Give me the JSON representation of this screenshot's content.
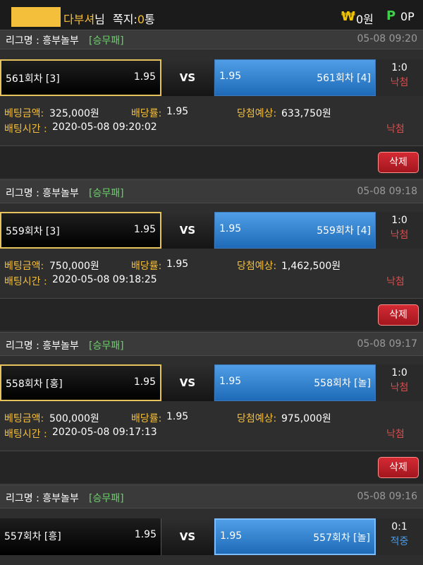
{
  "header": {
    "nickname_suffix": "다부셔",
    "honorific": "님",
    "message_label": "쪽지:",
    "message_count": "0",
    "message_unit": "통",
    "money_icon": "won-icon",
    "money_symbol": "₩",
    "money": "0원",
    "point_icon": "p-icon",
    "point_symbol": "P",
    "point": "0P"
  },
  "labels": {
    "league_prefix": "리그명 : ",
    "bet_amount": "베팅금액: ",
    "odds_rate": "배당률: ",
    "expected": "당첨예상: ",
    "bet_time": "배팅시간 : ",
    "vs": "VS",
    "delete": "삭제"
  },
  "bets": [
    {
      "league": "흥부놀부",
      "bet_type": "[승무패]",
      "time": "05-08 09:20",
      "home_team": "561회차 [3]",
      "home_odds": "1.95",
      "away_odds": "1.95",
      "away_team": "561회차 [4]",
      "score": "1:0",
      "result": "낙첨",
      "amount": "325,000원",
      "rate": "1.95",
      "expected": "633,750원",
      "bet_time": "2020-05-08 09:20:02",
      "final_result": "낙첨"
    },
    {
      "league": "흥부놀부",
      "bet_type": "[승무패]",
      "time": "05-08 09:18",
      "home_team": "559회차 [3]",
      "home_odds": "1.95",
      "away_odds": "1.95",
      "away_team": "559회차 [4]",
      "score": "1:0",
      "result": "낙첨",
      "amount": "750,000원",
      "rate": "1.95",
      "expected": "1,462,500원",
      "bet_time": "2020-05-08 09:18:25",
      "final_result": "낙첨"
    },
    {
      "league": "흥부놀부",
      "bet_type": "[승무패]",
      "time": "05-08 09:17",
      "home_team": "558회차 [홍]",
      "home_odds": "1.95",
      "away_odds": "1.95",
      "away_team": "558회차 [놀]",
      "score": "1:0",
      "result": "낙첨",
      "amount": "500,000원",
      "rate": "1.95",
      "expected": "975,000원",
      "bet_time": "2020-05-08 09:17:13",
      "final_result": "낙첨"
    },
    {
      "league": "흥부놀부",
      "bet_type": "[승무패]",
      "time": "05-08 09:16",
      "home_team": "557회차 [흥]",
      "home_odds": "1.95",
      "away_odds": "1.95",
      "away_team": "557회차 [놀]",
      "score": "0:1",
      "result": "적중"
    }
  ],
  "colors": {
    "accent_yellow": "#f4bf3b",
    "win_blue": "#4b9be6",
    "lose_red": "#e04a4a",
    "green": "#6ed16e",
    "delete_red": "#c0202a"
  }
}
